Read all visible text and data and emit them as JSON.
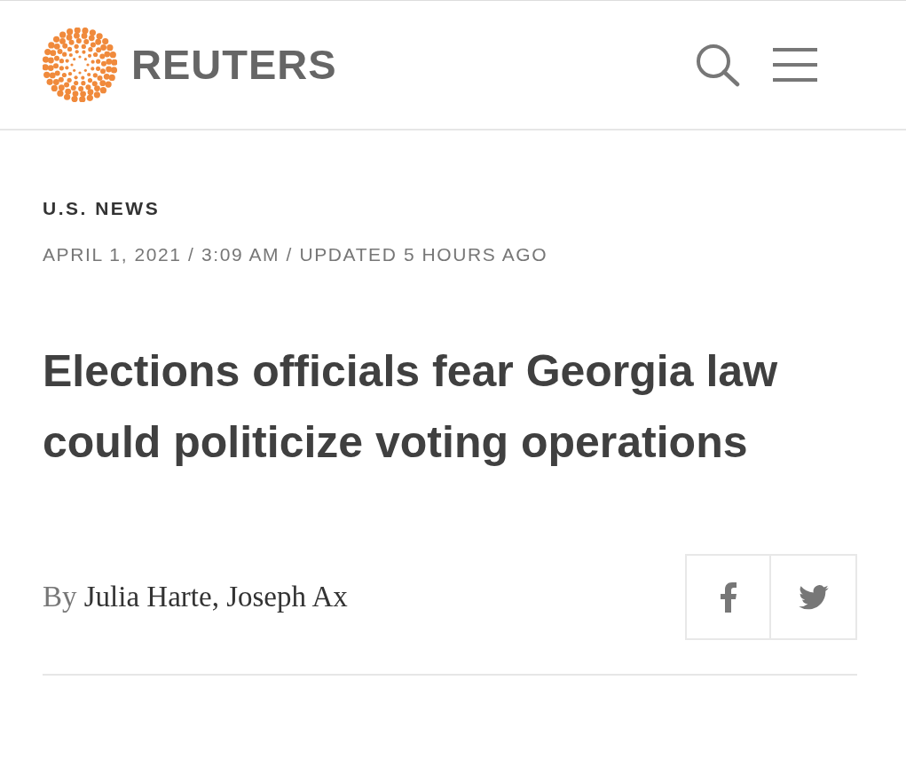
{
  "header": {
    "logo_text": "REUTERS"
  },
  "article": {
    "category": "U.S. NEWS",
    "dateline": "APRIL 1, 2021 / 3:09 AM / UPDATED 5 HOURS AGO",
    "headline": "Elections officials fear Georgia law could politicize voting operations",
    "byline": {
      "prefix": "By",
      "authors": "Julia Harte, Joseph Ax"
    }
  },
  "share_buttons": [
    {
      "kind": "facebook"
    },
    {
      "kind": "twitter"
    }
  ]
}
